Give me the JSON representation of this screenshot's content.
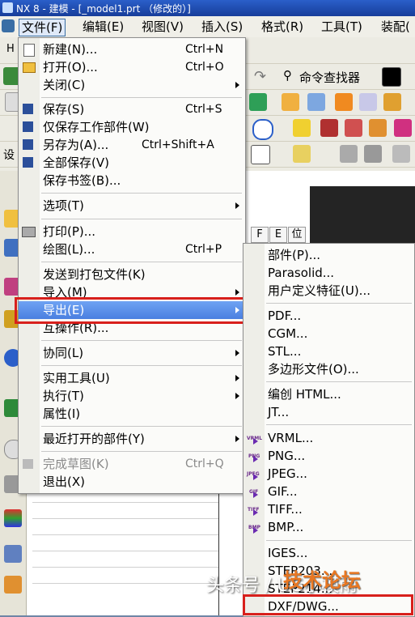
{
  "window": {
    "title": "NX 8 - 建模 - [_model1.prt （修改的）]"
  },
  "menubar": {
    "items": [
      "文件(F)",
      "编辑(E)",
      "视图(V)",
      "插入(S)",
      "格式(R)",
      "工具(T)",
      "装配("
    ]
  },
  "toolbar": {
    "command_finder": "命令查找器",
    "left_partial_1": "H",
    "left_partial_2": "设"
  },
  "header_cells": [
    "F",
    "E",
    "位"
  ],
  "file_menu": {
    "items": [
      {
        "label": "新建(N)...",
        "shortcut": "Ctrl+N"
      },
      {
        "label": "打开(O)...",
        "shortcut": "Ctrl+O"
      },
      {
        "label": "关闭(C)",
        "shortcut": ""
      },
      {
        "label": "保存(S)",
        "shortcut": "Ctrl+S"
      },
      {
        "label": "仅保存工作部件(W)",
        "shortcut": ""
      },
      {
        "label": "另存为(A)...",
        "shortcut": "Ctrl+Shift+A"
      },
      {
        "label": "全部保存(V)",
        "shortcut": ""
      },
      {
        "label": "保存书签(B)...",
        "shortcut": ""
      },
      {
        "label": "选项(T)",
        "shortcut": ""
      },
      {
        "label": "打印(P)...",
        "shortcut": ""
      },
      {
        "label": "绘图(L)...",
        "shortcut": "Ctrl+P"
      },
      {
        "label": "发送到打包文件(K)",
        "shortcut": ""
      },
      {
        "label": "导入(M)",
        "shortcut": ""
      },
      {
        "label": "导出(E)",
        "shortcut": ""
      },
      {
        "label": "互操作(R)...",
        "shortcut": ""
      },
      {
        "label": "协同(L)",
        "shortcut": ""
      },
      {
        "label": "实用工具(U)",
        "shortcut": ""
      },
      {
        "label": "执行(T)",
        "shortcut": ""
      },
      {
        "label": "属性(I)",
        "shortcut": ""
      },
      {
        "label": "最近打开的部件(Y)",
        "shortcut": ""
      },
      {
        "label": "完成草图(K)",
        "shortcut": "Ctrl+Q"
      },
      {
        "label": "退出(X)",
        "shortcut": ""
      }
    ]
  },
  "export_menu": {
    "items": [
      {
        "label": "部件(P)..."
      },
      {
        "label": "Parasolid..."
      },
      {
        "label": "用户定义特征(U)..."
      },
      {
        "label": "PDF..."
      },
      {
        "label": "CGM..."
      },
      {
        "label": "STL..."
      },
      {
        "label": "多边形文件(O)..."
      },
      {
        "label": "编创 HTML..."
      },
      {
        "label": "JT..."
      },
      {
        "label": "VRML..."
      },
      {
        "label": "PNG..."
      },
      {
        "label": "JPEG..."
      },
      {
        "label": "GIF..."
      },
      {
        "label": "TIFF..."
      },
      {
        "label": "BMP..."
      },
      {
        "label": "IGES..."
      },
      {
        "label": "STEP203..."
      },
      {
        "label": "STEP214..."
      },
      {
        "label": "DXF/DWG..."
      }
    ],
    "mini_tags": [
      "VRML",
      "PNG",
      "JPEG",
      "GIF",
      "TIFF",
      "BMP"
    ]
  },
  "watermark": {
    "text": "头条号 / UG小模雨",
    "brand": "技术论坛"
  },
  "colors": {
    "highlight": "#4a7fe0",
    "annotation_red": "#d8201c",
    "titlebar": "#2b5fc9"
  }
}
